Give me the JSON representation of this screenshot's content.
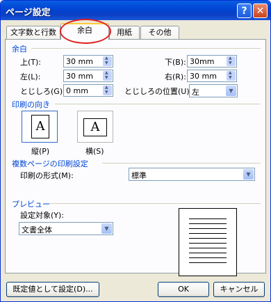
{
  "window": {
    "title": "ページ設定",
    "help_glyph": "?",
    "close_glyph": "✕"
  },
  "tabs": [
    {
      "label": "文字数と行数",
      "active": false
    },
    {
      "label": "余白",
      "active": true
    },
    {
      "label": "用紙",
      "active": false
    },
    {
      "label": "その他",
      "active": false
    }
  ],
  "margins": {
    "group_label": "余白",
    "top_label": "上(T):",
    "top_value": "30 mm",
    "bottom_label": "下(B):",
    "bottom_value": "30mm",
    "left_label": "左(L):",
    "left_value": "30 mm",
    "right_label": "右(R):",
    "right_value": "30 mm",
    "gutter_label": "とじしろ(G):",
    "gutter_value": "0 mm",
    "gutter_pos_label": "とじしろの位置(U):",
    "gutter_pos_value": "左"
  },
  "orientation": {
    "group_label": "印刷の向き",
    "portrait_label": "縦(P)",
    "landscape_label": "横(S)",
    "icon_letter": "A",
    "selected": "portrait"
  },
  "multiple_pages": {
    "group_label": "複数ページの印刷設定",
    "format_label": "印刷の形式(M):",
    "format_value": "標準"
  },
  "preview": {
    "group_label": "プレビュー",
    "apply_label": "設定対象(Y):",
    "apply_value": "文書全体"
  },
  "buttons": {
    "default": "既定値として設定(D)...",
    "ok": "OK",
    "cancel": "キャンセル"
  },
  "colors": {
    "titlebar": "#0a5ee0",
    "group_label": "#0046d5",
    "highlight_circle": "#e02020"
  }
}
